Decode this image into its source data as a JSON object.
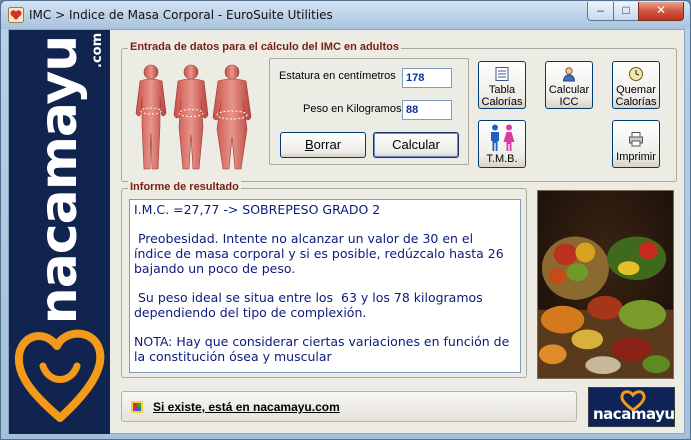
{
  "window": {
    "title": "IMC > Indice de Masa Corporal - EuroSuite Utilities",
    "min_label": "–",
    "max_label": "□",
    "close_label": "✕"
  },
  "brand": {
    "word": "nacamayu",
    "suffix": ".com",
    "logo_text": "nacamayu"
  },
  "entrada": {
    "legend": "Entrada de datos para el cálculo del IMC en adultos",
    "height_label": "Estatura en centímetros",
    "height_value": "178",
    "weight_label": "Peso en Kilogramos",
    "weight_value": "88",
    "clear_button": "Borrar",
    "clear_button_rest": "orrar",
    "clear_button_key": "B",
    "calc_button": "Calcular"
  },
  "tools": {
    "tabla": [
      "Tabla",
      "Calorías"
    ],
    "icc": [
      "Calcular",
      "ICC"
    ],
    "quemar": [
      "Quemar",
      "Calorías"
    ],
    "tmb": "T.M.B.",
    "imprimir": "Imprimir"
  },
  "informe": {
    "legend": "Informe de resultado",
    "lines": [
      "I.M.C. =27,77 -> SOBREPESO GRADO 2",
      " Preobesidad. Intente no alcanzar un valor de 30 en el índice de masa corporal y si es posible, redúzcalo hasta 26 bajando un poco de peso.",
      " Su peso ideal se situa entre los  63 y los 78 kilogramos dependiendo del tipo de complexión.",
      "NOTA: Hay que considerar ciertas variaciones en función de la constitución ósea y muscular"
    ]
  },
  "footer": {
    "link": "Si existe, está en nacamayu.com"
  },
  "colors": {
    "legend": "#7a1e12",
    "result_text": "#0b1b7c",
    "brand_panel": "#10244f",
    "heart": "#f39a1a"
  },
  "icons": [
    "app-heart-icon",
    "body-figures-icon",
    "table-icon",
    "person-icon",
    "clock-icon",
    "male-female-icon",
    "printer-icon",
    "globe-icon",
    "heart-logo-icon"
  ]
}
